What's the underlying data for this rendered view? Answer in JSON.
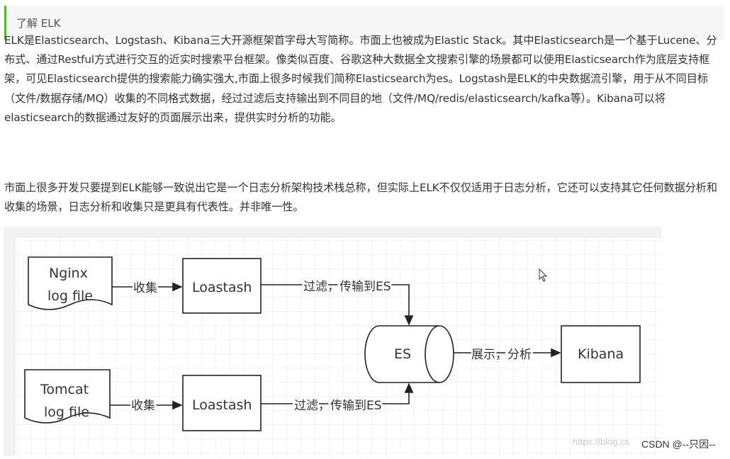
{
  "heading": "了解 ELK",
  "paragraphs": [
    "ELK是Elasticsearch、Logstash、Kibana三大开源框架首字母大写简称。市面上也被成为Elastic Stack。其中Elasticsearch是一个基于Lucene、分布式、通过Restful方式进行交互的近实时搜索平台框架。像类似百度、谷歌这种大数据全文搜索引擎的场景都可以使用Elasticsearch作为底层支持框架，可见Elasticsearch提供的搜索能力确实强大,市面上很多时候我们简称Elasticsearch为es。Logstash是ELK的中央数据流引擎，用于从不同目标（文件/数据存储/MQ）收集的不同格式数据，经过过滤后支持输出到不同目的地（文件/MQ/redis/elasticsearch/kafka等）。Kibana可以将elasticsearch的数据通过友好的页面展示出来，提供实时分析的功能。",
    "市面上很多开发只要提到ELK能够一致说出它是一个日志分析架构技术栈总称，但实际上ELK不仅仅适用于日志分析，它还可以支持其它任何数据分析和收集的场景，日志分析和收集只是更具有代表性。并非唯一性。"
  ],
  "diagram": {
    "nginx": [
      "Nginx",
      "log file"
    ],
    "tomcat": [
      "Tomcat",
      "log file"
    ],
    "collect": "收集",
    "logstash": "Loastash",
    "filter": "过滤，传输到ES",
    "es": "ES",
    "show": "展示，分析",
    "kibana": "Kibana"
  },
  "watermark": {
    "url": "https://blog.cs",
    "author": "CSDN @--只因--"
  }
}
